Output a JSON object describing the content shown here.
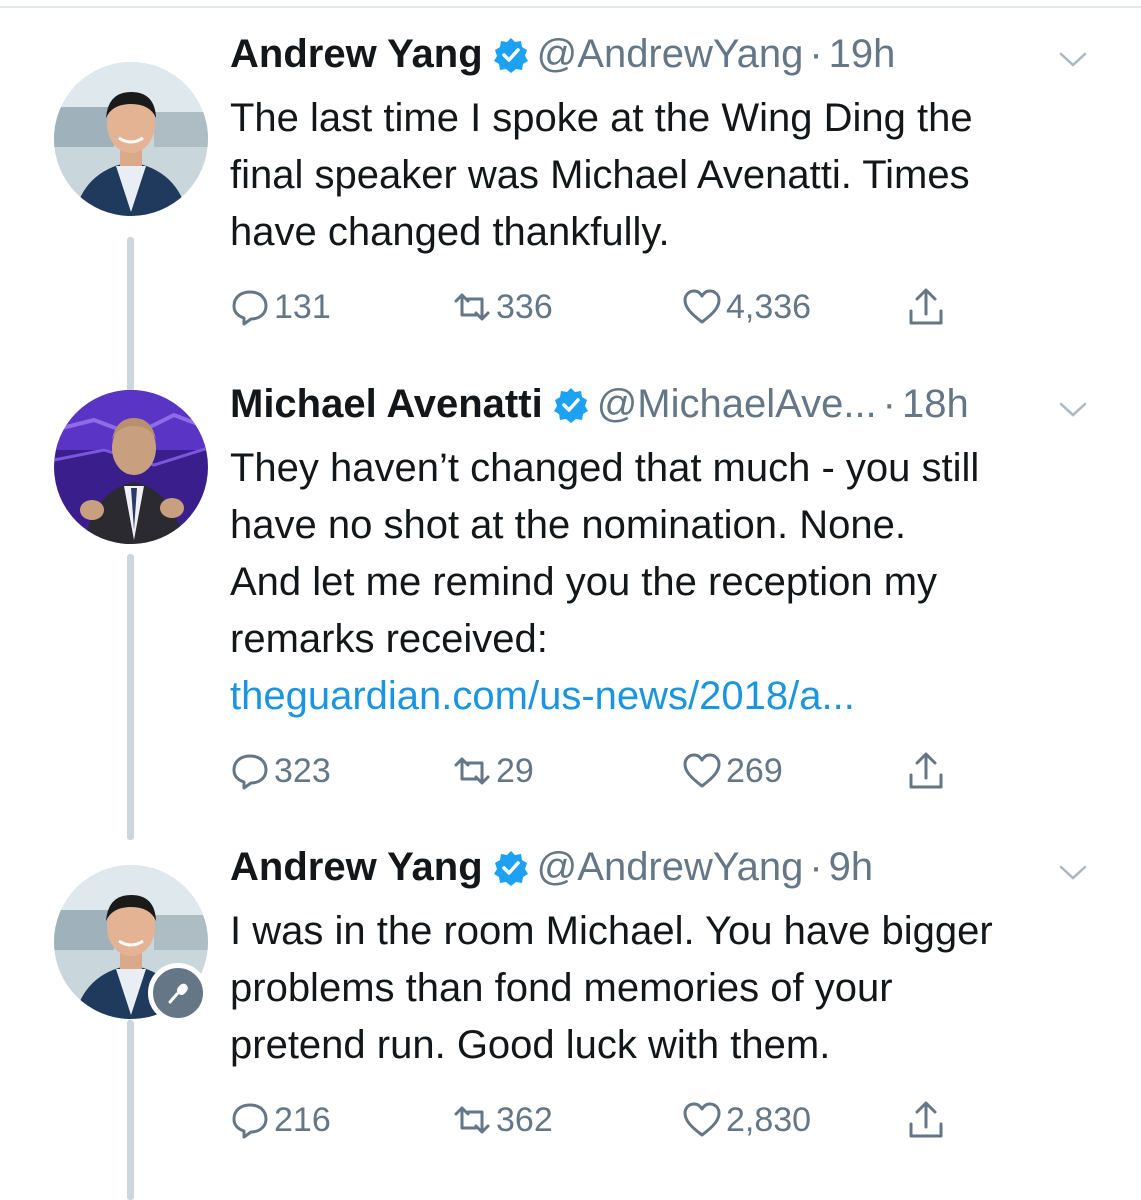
{
  "tweets": [
    {
      "name": "Andrew Yang",
      "handle": "@AndrewYang",
      "separator": "·",
      "time": "19h",
      "lines": [
        "The last time I spoke at the Wing Ding the",
        "final speaker was Michael Avenatti.  Times",
        "have changed thankfully."
      ],
      "replies": "131",
      "retweets": "336",
      "likes": "4,336"
    },
    {
      "name": "Michael Avenatti",
      "handle": "@MichaelAve...",
      "separator": "·",
      "time": "18h",
      "lines": [
        "They haven’t changed that much - you still",
        "have no shot at the nomination.  None.",
        "And let me remind you the reception my",
        "remarks received:"
      ],
      "link": "theguardian.com/us-news/2018/a...",
      "replies": "323",
      "retweets": "29",
      "likes": "269"
    },
    {
      "name": "Andrew Yang",
      "handle": "@AndrewYang",
      "separator": "·",
      "time": "9h",
      "lines": [
        "I was in the room Michael. You have bigger",
        "problems than fond memories of your",
        "pretend run. Good luck with them."
      ],
      "replies": "216",
      "retweets": "362",
      "likes": "2,830"
    }
  ],
  "icons": {
    "verified": "verified-badge-icon",
    "caret": "chevron-down-icon",
    "reply": "reply-icon",
    "retweet": "retweet-icon",
    "like": "heart-icon",
    "share": "share-icon",
    "mic": "microphone-icon"
  },
  "colors": {
    "verified": "#1da1f2",
    "link": "#1b95e0",
    "secondary_text": "#657786",
    "thread_line": "#ccd6dd"
  }
}
